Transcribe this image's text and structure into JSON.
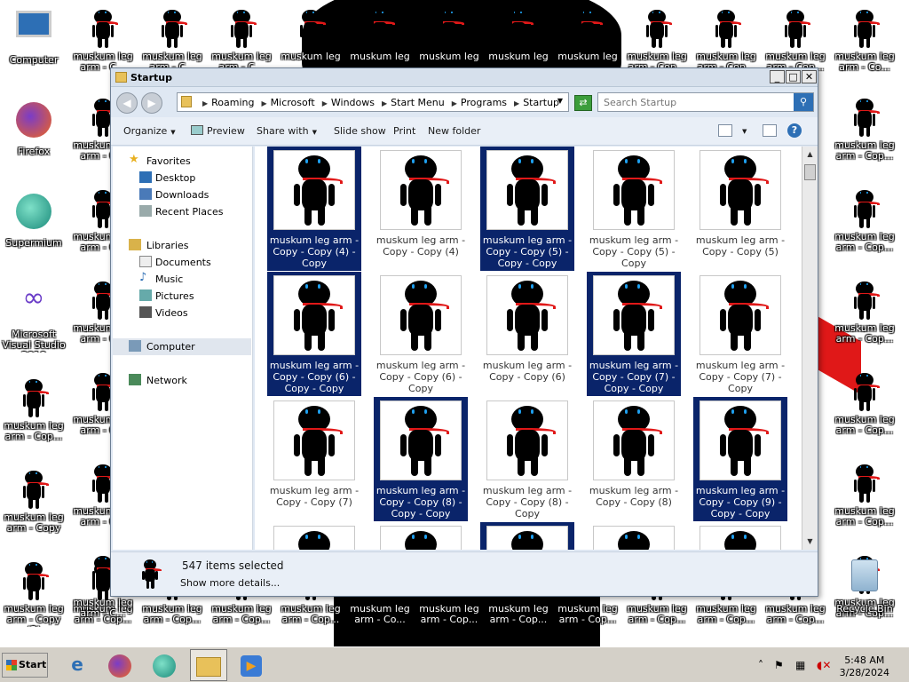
{
  "desktop": {
    "icons_left": [
      {
        "label": "Computer",
        "icon": "computer-icon"
      },
      {
        "label": "Firefox",
        "icon": "firefox-icon"
      },
      {
        "label": "Supermium",
        "icon": "supermium-icon"
      },
      {
        "label": "Microsoft Visual Studio 2010",
        "icon": "visual-studio-icon"
      },
      {
        "label": "muskum leg arm - Cop...",
        "icon": "stick-figure-icon"
      },
      {
        "label": "muskum leg arm - Copy",
        "icon": "stick-figure-icon"
      },
      {
        "label": "muskum leg arm - Copy (2)",
        "icon": "stick-figure-icon"
      }
    ],
    "top_row_labels": [
      "muskum leg arm - C...",
      "muskum leg arm - C...",
      "muskum leg arm - C...",
      "muskum leg",
      "muskum leg",
      "muskum leg",
      "muskum leg",
      "muskum leg",
      "muskum leg arm - Cop...",
      "muskum leg arm - Cop...",
      "muskum leg arm - Cop...",
      "muskum leg arm - Co..."
    ],
    "bottom_row_labels": [
      "muskum leg arm - Cop...",
      "muskum leg arm - Cop...",
      "muskum leg arm - Cop...",
      "muskum leg arm - Cop...",
      "muskum leg arm - Co...",
      "muskum leg arm - Cop...",
      "muskum leg arm - Cop...",
      "muskum leg arm - Cop...",
      "muskum leg arm - Cop...",
      "muskum leg arm - Cop...",
      "muskum leg arm - Cop..."
    ],
    "right_labels": [
      "muskum leg arm - Cop...",
      "muskum leg arm - Cop...",
      "muskum leg arm - Cop...",
      "muskum leg arm - Cop...",
      "muskum leg arm - Cop...",
      "muskum leg arm - Cop..."
    ],
    "col2_labels": [
      "muskum leg arm - C...",
      "muskum leg arm - C...",
      "muskum leg arm - C...",
      "muskum leg arm - C...",
      "muskum leg arm - C...",
      "muskum leg arm - C..."
    ],
    "recycle_bin": "Recycle Bin"
  },
  "window": {
    "title": "Startup",
    "breadcrumbs": [
      "Roaming",
      "Microsoft",
      "Windows",
      "Start Menu",
      "Programs",
      "Startup"
    ],
    "search_placeholder": "Search Startup",
    "toolbar": {
      "organize": "Organize",
      "preview": "Preview",
      "share_with": "Share with",
      "slide_show": "Slide show",
      "print": "Print",
      "new_folder": "New folder"
    },
    "nav": {
      "favorites": "Favorites",
      "desktop": "Desktop",
      "downloads": "Downloads",
      "recent_places": "Recent Places",
      "libraries": "Libraries",
      "documents": "Documents",
      "music": "Music",
      "pictures": "Pictures",
      "videos": "Videos",
      "computer": "Computer",
      "network": "Network"
    },
    "files": [
      {
        "name": "muskum leg arm - Copy - Copy (4) - Copy",
        "selected": true
      },
      {
        "name": "muskum leg arm - Copy - Copy (4)",
        "selected": false
      },
      {
        "name": "muskum leg arm - Copy - Copy (5) - Copy - Copy",
        "selected": true
      },
      {
        "name": "muskum leg arm - Copy - Copy (5) - Copy",
        "selected": false
      },
      {
        "name": "muskum leg arm - Copy - Copy (5)",
        "selected": false
      },
      {
        "name": "muskum leg arm - Copy - Copy (6) - Copy - Copy",
        "selected": true
      },
      {
        "name": "muskum leg arm - Copy - Copy (6) - Copy",
        "selected": false
      },
      {
        "name": "muskum leg arm - Copy - Copy (6)",
        "selected": false
      },
      {
        "name": "muskum leg arm - Copy - Copy (7) - Copy - Copy",
        "selected": true
      },
      {
        "name": "muskum leg arm - Copy - Copy (7) - Copy",
        "selected": false
      },
      {
        "name": "muskum leg arm - Copy - Copy (7)",
        "selected": false
      },
      {
        "name": "muskum leg arm - Copy - Copy (8) - Copy - Copy",
        "selected": true
      },
      {
        "name": "muskum leg arm - Copy - Copy (8) - Copy",
        "selected": false
      },
      {
        "name": "muskum leg arm - Copy - Copy (8)",
        "selected": false
      },
      {
        "name": "muskum leg arm - Copy - Copy (9) - Copy - Copy",
        "selected": true
      },
      {
        "name": "",
        "selected": false
      },
      {
        "name": "",
        "selected": false
      },
      {
        "name": "",
        "selected": true
      },
      {
        "name": "",
        "selected": false
      },
      {
        "name": "",
        "selected": false
      }
    ],
    "details": {
      "count": "547 items selected",
      "more": "Show more details..."
    }
  },
  "taskbar": {
    "start": "Start",
    "apps": [
      "internet-explorer-icon",
      "firefox-icon",
      "supermium-icon",
      "explorer-icon",
      "media-player-icon"
    ],
    "time": "5:48 AM",
    "date": "3/28/2024"
  },
  "colors": {
    "selection": "#0a246a",
    "accent": "#2d6fb5"
  }
}
